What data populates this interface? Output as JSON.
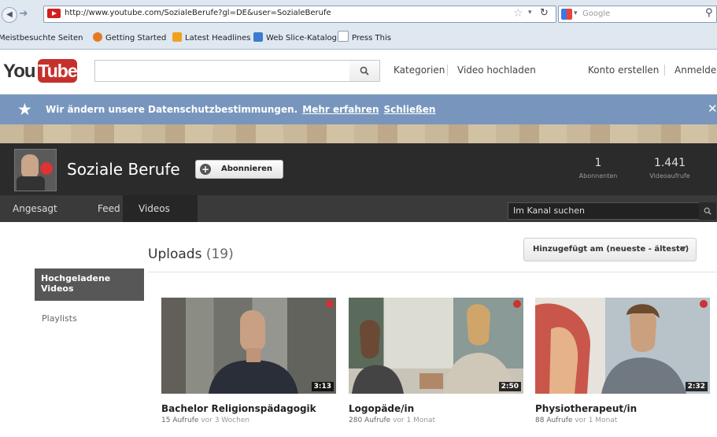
{
  "browser": {
    "url": "http://www.youtube.com/SozialeBerufe?gl=DE&user=SozialeBerufe",
    "search_engine": "Google",
    "bookmarks": [
      "Meistbesuchte Seiten",
      "Getting Started",
      "Latest Headlines",
      "Web Slice-Katalog",
      "Press This"
    ]
  },
  "yt": {
    "logo_you": "You",
    "logo_tube": "Tube",
    "search_placeholder": "",
    "links": {
      "kategorien": "Kategorien",
      "hochladen": "Video hochladen",
      "konto": "Konto erstellen",
      "anmelden": "Anmelden"
    }
  },
  "banner": {
    "text": "Wir ändern unsere Datenschutzbestimmungen.",
    "more": "Mehr erfahren",
    "close": "Schließen"
  },
  "channel": {
    "name": "Soziale Berufe",
    "subscribe": "Abonnieren",
    "subscribers": "1",
    "subscribers_label": "Abonnenten",
    "views": "1.441",
    "views_label": "Videoaufrufe",
    "tabs": [
      "Angesagt",
      "Feed",
      "Videos"
    ],
    "search_placeholder": "Im Kanal suchen"
  },
  "sidebar": {
    "active": "Hochgeladene Videos",
    "playlists": "Playlists"
  },
  "uploads": {
    "title": "Uploads",
    "count": "(19)",
    "sort": "Hinzugefügt am (neueste - älteste)",
    "videos": [
      {
        "title": "Bachelor Religionspädagogik",
        "views": "15 Aufrufe",
        "ago": "vor 3 Wochen",
        "duration": "3:13"
      },
      {
        "title": "Logopäde/in",
        "views": "280 Aufrufe",
        "ago": "vor 1 Monat",
        "duration": "2:50"
      },
      {
        "title": "Physiotherapeut/in",
        "views": "88 Aufrufe",
        "ago": "vor 1 Monat",
        "duration": "2:32"
      }
    ]
  }
}
